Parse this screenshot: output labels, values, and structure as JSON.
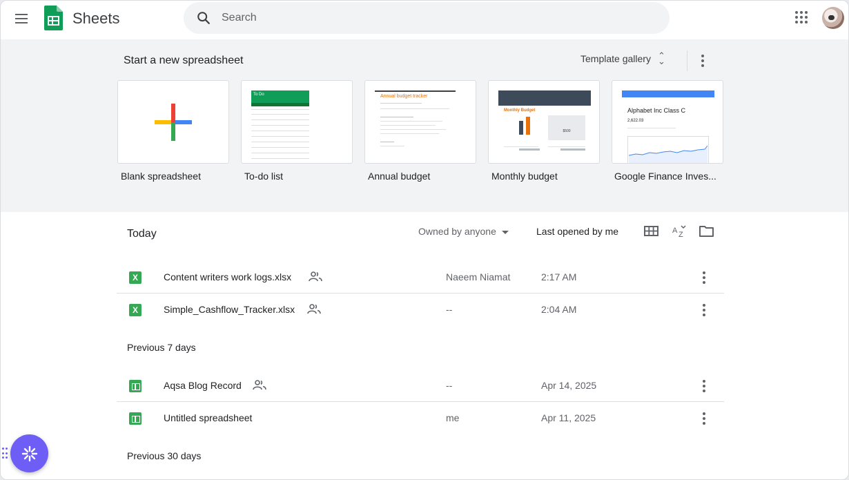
{
  "header": {
    "app_name": "Sheets",
    "search_placeholder": "Search"
  },
  "templates": {
    "heading": "Start a new spreadsheet",
    "gallery_label": "Template gallery",
    "cards": [
      {
        "label": "Blank spreadsheet"
      },
      {
        "label": "To-do list",
        "preview_title": "To Do"
      },
      {
        "label": "Annual budget",
        "preview_title": "Annual budget tracker"
      },
      {
        "label": "Monthly budget",
        "preview_title": "Monthly Budget",
        "preview_value": "$500"
      },
      {
        "label": "Google Finance Inves...",
        "preview_title": "Alphabet Inc Class C",
        "preview_value": "2,622.03"
      }
    ]
  },
  "list": {
    "title": "Today",
    "owner_filter": "Owned by anyone",
    "sort_label": "Last opened by me",
    "sections": [
      {
        "label": "",
        "files": [
          {
            "name": "Content writers work logs.xlsx",
            "type": "xlsx",
            "shared": true,
            "owner": "Naeem Niamat",
            "time": "2:17 AM"
          },
          {
            "name": "Simple_Cashflow_Tracker.xlsx",
            "type": "xlsx",
            "shared": true,
            "owner": "--",
            "time": "2:04 AM"
          }
        ]
      },
      {
        "label": "Previous 7 days",
        "files": [
          {
            "name": "Aqsa Blog Record",
            "type": "sheet",
            "shared": true,
            "owner": "--",
            "time": "Apr 14, 2025"
          },
          {
            "name": "Untitled spreadsheet",
            "type": "sheet",
            "shared": false,
            "owner": "me",
            "time": "Apr 11, 2025"
          }
        ]
      },
      {
        "label": "Previous 30 days",
        "files": []
      }
    ]
  },
  "colors": {
    "accent": "#34a853",
    "fab": "#6f5ef6"
  }
}
